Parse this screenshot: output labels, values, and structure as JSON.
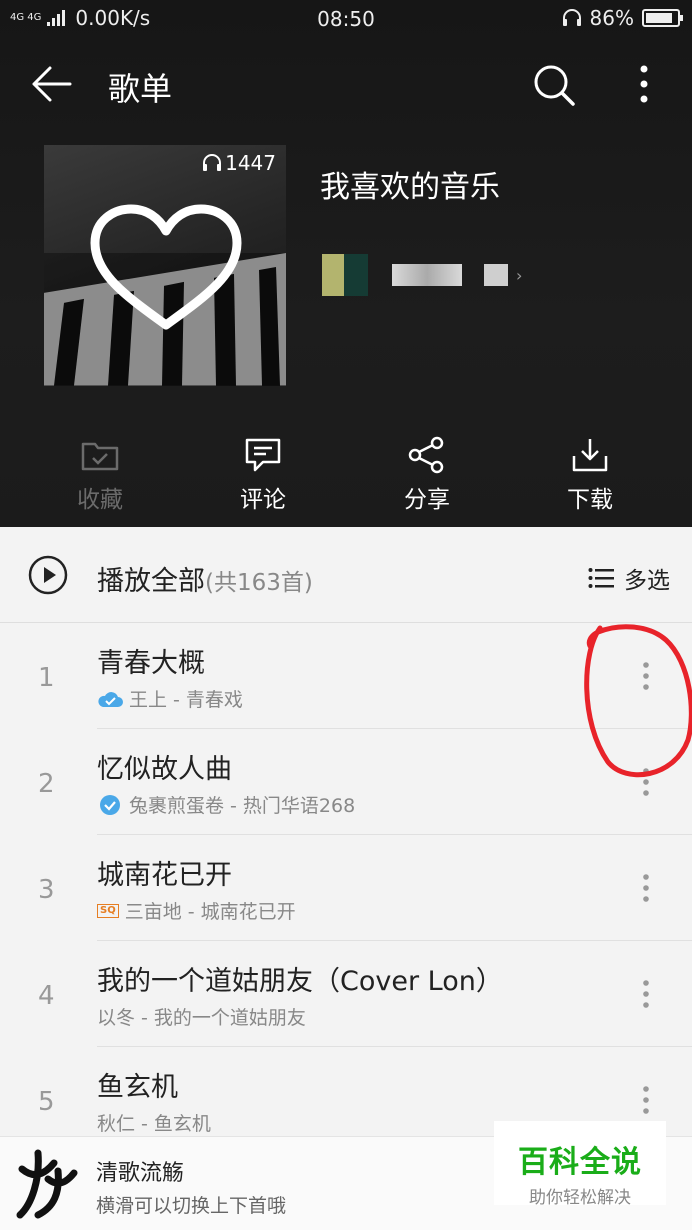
{
  "status_bar": {
    "network": "4G 4G",
    "speed": "0.00K/s",
    "time": "08:50",
    "battery": "86%",
    "battery_level": 0.86
  },
  "nav": {
    "title": "歌单"
  },
  "playlist": {
    "listen_count": "1447",
    "name": "我喜欢的音乐"
  },
  "actions": [
    {
      "label": "收藏",
      "icon": "folder-check-icon",
      "enabled": false
    },
    {
      "label": "评论",
      "icon": "comment-icon",
      "enabled": true
    },
    {
      "label": "分享",
      "icon": "share-icon",
      "enabled": true
    },
    {
      "label": "下载",
      "icon": "download-icon",
      "enabled": true
    }
  ],
  "play_all": {
    "label": "播放全部",
    "count": "(共163首)",
    "multi_select": "多选"
  },
  "songs": [
    {
      "index": "1",
      "title": "青春大概",
      "subtitle": "王上 - 青春戏",
      "badge": "cloud-check-icon"
    },
    {
      "index": "2",
      "title": "忆似故人曲",
      "subtitle": "兔裹煎蛋卷 - 热门华语268",
      "badge": "check-circle-icon"
    },
    {
      "index": "3",
      "title": "城南花已开",
      "subtitle": "三亩地 - 城南花已开",
      "badge": "sq-badge"
    },
    {
      "index": "4",
      "title": "我的一个道姑朋友（Cover Lon）",
      "subtitle": "以冬 - 我的一个道姑朋友",
      "badge": ""
    },
    {
      "index": "5",
      "title": "鱼玄机",
      "subtitle": "秋仁 - 鱼玄机",
      "badge": ""
    }
  ],
  "mini_player": {
    "song": "清歌流觞",
    "hint": "横滑可以切换上下首哦"
  },
  "watermark": {
    "title": "百科全说",
    "subtitle": "助你轻松解决"
  },
  "colors": {
    "annotation": "#e8232a",
    "header_bg": "#1b1b1b",
    "watermark_green": "#1aad19"
  }
}
